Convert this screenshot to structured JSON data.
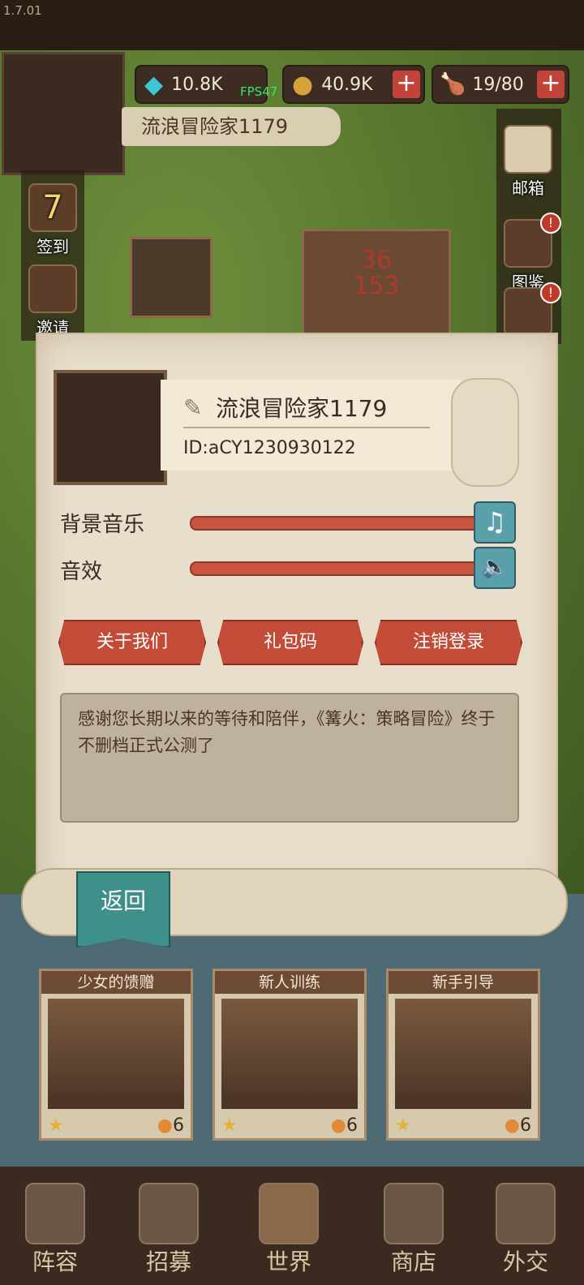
{
  "app": {
    "version": "1.7.01",
    "fps": "FPS47"
  },
  "resources": {
    "gems": "10.8K",
    "gold": "40.9K",
    "food": "19/80",
    "plus": "+"
  },
  "player": {
    "name_banner": "流浪冒险家1179",
    "name": "流浪冒险家1179",
    "id": "ID:aCY1230930122"
  },
  "side_menu": {
    "checkin_label": "签到",
    "checkin_day": "7",
    "invite_label": "邀请",
    "mail_label": "邮箱",
    "codex_label": "图鉴",
    "badge": "!"
  },
  "map": {
    "enemy_numbers": "36\n153"
  },
  "settings": {
    "music_label": "背景音乐",
    "sfx_label": "音效",
    "music_level": 1.0,
    "sfx_level": 1.0,
    "music_icon": "♫",
    "sfx_icon": "🔈"
  },
  "buttons": {
    "about": "关于我们",
    "gift_code": "礼包码",
    "logout": "注销登录",
    "back": "返回"
  },
  "notice": {
    "text": "感谢您长期以来的等待和陪伴，《篝火：策略冒险》终于不删档正式公测了"
  },
  "missions": [
    {
      "title": "少女的馈赠",
      "cost": "6"
    },
    {
      "title": "新人训练",
      "cost": "6"
    },
    {
      "title": "新手引导",
      "cost": "6"
    }
  ],
  "nav": {
    "lineup": "阵容",
    "recruit": "招募",
    "world": "世界",
    "shop": "商店",
    "diplomacy": "外交"
  },
  "colors": {
    "accent_red": "#c24c37",
    "teal": "#3f8f8a",
    "parchment": "#e8decc"
  }
}
